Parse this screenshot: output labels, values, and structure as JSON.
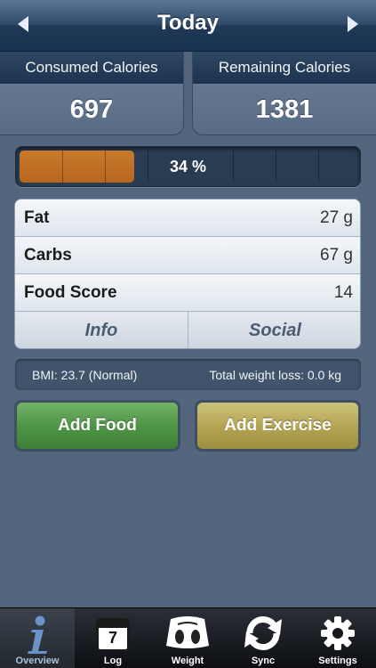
{
  "header": {
    "title": "Today"
  },
  "calories": {
    "consumed": {
      "label": "Consumed Calories",
      "value": "697"
    },
    "remaining": {
      "label": "Remaining Calories",
      "value": "1381"
    }
  },
  "progress": {
    "text": "34 %",
    "fraction": 0.34
  },
  "nutrients": [
    {
      "label": "Fat",
      "value": "27 g"
    },
    {
      "label": "Carbs",
      "value": "67 g"
    },
    {
      "label": "Food Score",
      "value": "14"
    }
  ],
  "tabs": {
    "info": "Info",
    "social": "Social"
  },
  "stats": {
    "bmi": "BMI:  23.7  (Normal)",
    "weight_loss": "Total weight loss: 0.0 kg"
  },
  "buttons": {
    "add_food": "Add Food",
    "add_exercise": "Add Exercise"
  },
  "tabbar": {
    "items": [
      {
        "label": "Overview",
        "icon": "info-icon"
      },
      {
        "label": "Log",
        "icon": "calendar-icon",
        "day": "7"
      },
      {
        "label": "Weight",
        "icon": "scale-icon"
      },
      {
        "label": "Sync",
        "icon": "sync-icon"
      },
      {
        "label": "Settings",
        "icon": "gear-icon"
      }
    ]
  },
  "colors": {
    "accent_green": "#4f9547",
    "accent_gold": "#b4a654",
    "progress_fill": "#b8661e",
    "header_blue": "#1f3956"
  }
}
